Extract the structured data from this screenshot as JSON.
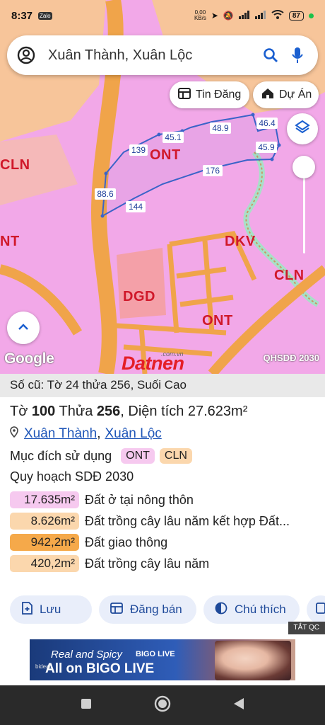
{
  "status_bar": {
    "time": "8:37",
    "app_badge": "Zalo",
    "network_speed": "0,00\nKB/s",
    "battery": "87"
  },
  "search": {
    "query": "Xuân Thành, Xuân Lộc"
  },
  "map": {
    "chip_listings": "Tin Đăng",
    "chip_projects": "Dự Án",
    "zones": [
      "CLN",
      "ONT",
      "NT",
      "DKV",
      "CLN",
      "DGD",
      "ONT"
    ],
    "edges": [
      "45.1",
      "48.9",
      "46.4",
      "139",
      "45.9",
      "176",
      "88.6",
      "144"
    ],
    "google_label": "Google",
    "layer_label": "QHSDĐ 2030",
    "watermark": "Datnen",
    "watermark_domain": ".com.vn"
  },
  "parcel": {
    "old_ref": "Số cũ: Tờ 24 thửa 256, Suối Cao",
    "sheet_label": "Tờ",
    "sheet_no": "100",
    "lot_label": "Thửa",
    "lot_no": "256",
    "area_text": ", Diện tích 27.623m²",
    "location_commune": "Xuân Thành",
    "location_sep": ",",
    "location_district": "Xuân Lộc",
    "purpose_label": "Mục đích sử dụng",
    "purpose_tags": [
      "ONT",
      "CLN"
    ],
    "plan_title": "Quy hoạch SDĐ 2030",
    "areas": [
      {
        "value": "17.635m²",
        "desc": "Đất ở tại nông thôn",
        "color": "#f6c9ef"
      },
      {
        "value": "8.626m²",
        "desc": "Đất trồng cây lâu năm kết hợp Đất...",
        "color": "#fbd7ad"
      },
      {
        "value": "942,2m²",
        "desc": "Đất giao thông",
        "color": "#f5a94a"
      },
      {
        "value": "420,2m²",
        "desc": "Đất trồng cây lâu năm",
        "color": "#fbd7ad"
      }
    ]
  },
  "actions": {
    "save": "Lưu",
    "post_sale": "Đăng bán",
    "legend": "Chú thích"
  },
  "ad": {
    "close_label": "TẮT QC",
    "line1": "Real and Spicy",
    "brand": "BIGO LIVE",
    "line2": "All on BIGO LIVE",
    "small_brand": "bideap"
  },
  "colors": {
    "residential": "#f2a8e8",
    "perennial": "#f7c59a",
    "road": "#f0a44a",
    "zone_text": "#d0182a",
    "boundary": "#3a63c8",
    "link": "#1f56b8"
  }
}
